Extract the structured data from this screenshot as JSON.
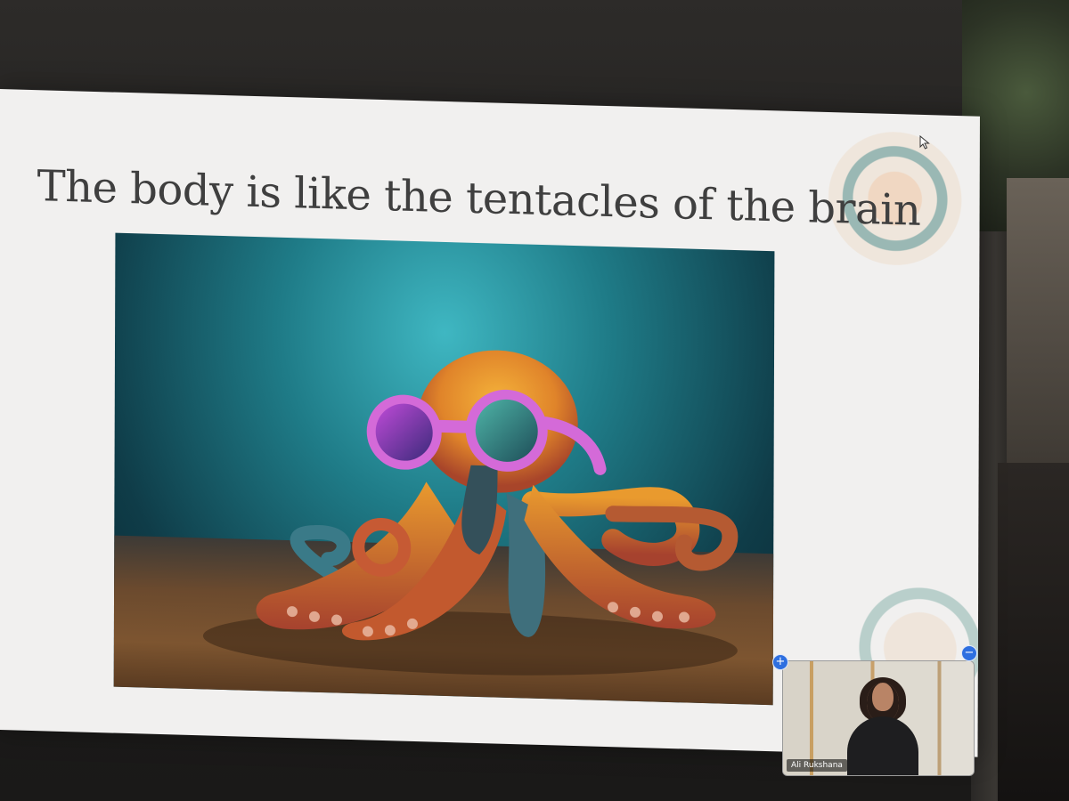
{
  "slide": {
    "title": "The body is like the tentacles of the brain"
  },
  "video_tile": {
    "participant_name": "Ali Rukshana",
    "add_symbol": "+",
    "minimize_symbol": "−"
  },
  "colors": {
    "slide_background": "#f1f0ef",
    "title_text": "#3f3f3f",
    "accent_ring_teal": "#9ab8b4",
    "accent_ring_peach": "#f0d7c2",
    "tile_button_blue": "#2e6fe0"
  },
  "icons": {
    "cursor": "mouse-pointer-icon",
    "add": "plus-icon",
    "minimize": "minus-icon"
  }
}
